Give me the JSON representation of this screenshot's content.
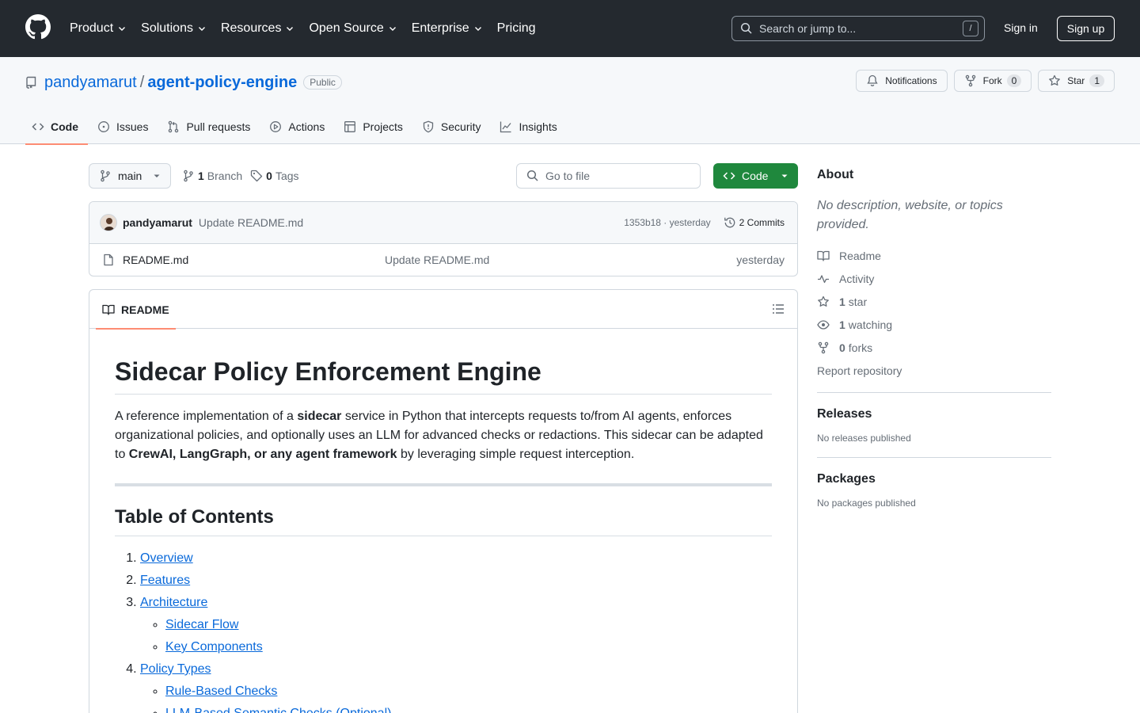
{
  "header": {
    "nav": [
      "Product",
      "Solutions",
      "Resources",
      "Open Source",
      "Enterprise",
      "Pricing"
    ],
    "search_placeholder": "Search or jump to...",
    "search_shortcut": "/",
    "sign_in": "Sign in",
    "sign_up": "Sign up"
  },
  "repo": {
    "owner": "pandyamarut",
    "separator": "/",
    "name": "agent-policy-engine",
    "visibility": "Public",
    "notifications_label": "Notifications",
    "fork_label": "Fork",
    "fork_count": "0",
    "star_label": "Star",
    "star_count": "1"
  },
  "tabs": [
    {
      "label": "Code",
      "icon": "code-icon",
      "active": true
    },
    {
      "label": "Issues",
      "icon": "issue-icon"
    },
    {
      "label": "Pull requests",
      "icon": "pull-request-icon"
    },
    {
      "label": "Actions",
      "icon": "play-icon"
    },
    {
      "label": "Projects",
      "icon": "table-icon"
    },
    {
      "label": "Security",
      "icon": "shield-icon"
    },
    {
      "label": "Insights",
      "icon": "graph-icon"
    }
  ],
  "toolbar": {
    "branch": "main",
    "branch_count": "1",
    "branch_label": "Branch",
    "tag_count": "0",
    "tag_label": "Tags",
    "goto_placeholder": "Go to file",
    "code_button": "Code"
  },
  "latest_commit": {
    "author": "pandyamarut",
    "message": "Update README.md",
    "hash_time": "1353b18 · yesterday",
    "commits": "2 Commits"
  },
  "files": [
    {
      "name": "README.md",
      "message": "Update README.md",
      "date": "yesterday"
    }
  ],
  "readme": {
    "tab": "README",
    "title": "Sidecar Policy Enforcement Engine",
    "intro_1": "A reference implementation of a ",
    "intro_bold_1": "sidecar",
    "intro_2": " service in Python that intercepts requests to/from AI agents, enforces organizational policies, and optionally uses an LLM for advanced checks or redactions. This sidecar can be adapted to ",
    "intro_bold_2": "CrewAI, LangGraph, or any agent framework",
    "intro_3": " by leveraging simple request interception.",
    "toc_title": "Table of Contents",
    "toc": {
      "overview": "Overview",
      "features": "Features",
      "architecture": "Architecture",
      "sidecar_flow": "Sidecar Flow",
      "key_components": "Key Components",
      "policy_types": "Policy Types",
      "rule_based": "Rule-Based Checks",
      "llm_based": "LLM-Based Semantic Checks (Optional)"
    }
  },
  "about": {
    "title": "About",
    "description": "No description, website, or topics provided.",
    "readme": "Readme",
    "activity": "Activity",
    "stars_count": "1",
    "stars_label": "star",
    "watching_count": "1",
    "watching_label": "watching",
    "forks_count": "0",
    "forks_label": "forks",
    "report": "Report repository"
  },
  "releases": {
    "title": "Releases",
    "text": "No releases published"
  },
  "packages": {
    "title": "Packages",
    "text": "No packages published"
  }
}
